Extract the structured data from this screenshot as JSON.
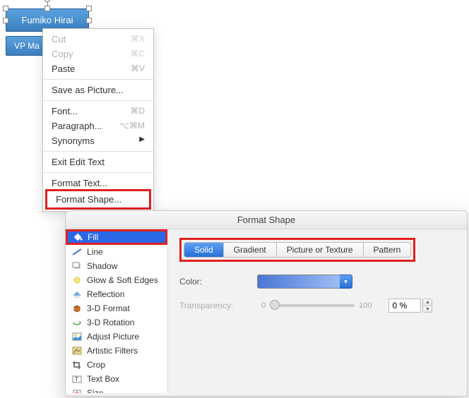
{
  "shape": {
    "name": "Fumiko Hirai",
    "title_partial": "VP Ma"
  },
  "context_menu": {
    "items": [
      {
        "label": "Cut",
        "shortcut": "⌘X",
        "disabled": true
      },
      {
        "label": "Copy",
        "shortcut": "⌘C",
        "disabled": true
      },
      {
        "label": "Paste",
        "shortcut": "⌘V"
      }
    ],
    "save_picture": "Save as Picture...",
    "font": {
      "label": "Font...",
      "shortcut": "⌘D"
    },
    "paragraph": {
      "label": "Paragraph...",
      "shortcut": "⌥⌘M"
    },
    "synonyms": "Synonyms",
    "exit_edit": "Exit Edit Text",
    "format_text": "Format Text...",
    "format_shape": "Format Shape..."
  },
  "dialog": {
    "title": "Format Shape",
    "sidebar": [
      {
        "label": "Fill",
        "selected": true,
        "icon": "paint-bucket-icon"
      },
      {
        "label": "Line",
        "icon": "line-icon"
      },
      {
        "label": "Shadow",
        "icon": "shadow-icon"
      },
      {
        "label": "Glow & Soft Edges",
        "icon": "glow-icon"
      },
      {
        "label": "Reflection",
        "icon": "reflection-icon"
      },
      {
        "label": "3-D Format",
        "icon": "cube-icon"
      },
      {
        "label": "3-D Rotation",
        "icon": "rotation-icon"
      },
      {
        "label": "Adjust Picture",
        "icon": "picture-icon"
      },
      {
        "label": "Artistic Filters",
        "icon": "filter-icon"
      },
      {
        "label": "Crop",
        "icon": "crop-icon"
      },
      {
        "label": "Text Box",
        "icon": "textbox-icon"
      },
      {
        "label": "Size",
        "icon": "size-icon"
      }
    ],
    "tabs": [
      "Solid",
      "Gradient",
      "Picture or Texture",
      "Pattern"
    ],
    "active_tab": "Solid",
    "color_label": "Color:",
    "transparency_label": "Transparency:",
    "transparency_min": "0",
    "transparency_max": "100",
    "transparency_value": "0 %"
  }
}
